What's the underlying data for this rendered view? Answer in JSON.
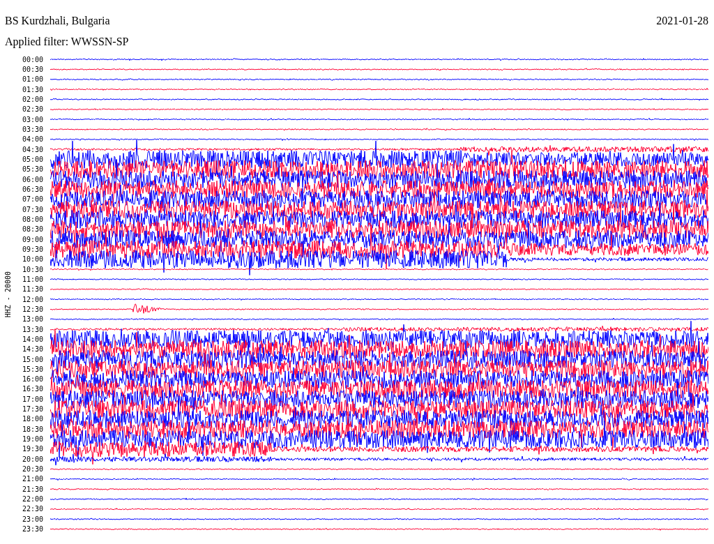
{
  "station": "BS Kurdzhali, Bulgaria",
  "date": "2021-01-28",
  "filter_label": "Applied filter: WWSSN-SP",
  "channel": "HHZ - 20000",
  "traces": [
    {
      "time": "00:00",
      "color": "#0000ff"
    },
    {
      "time": "00:30",
      "color": "#ff0033"
    },
    {
      "time": "01:00",
      "color": "#0000ff"
    },
    {
      "time": "01:30",
      "color": "#ff0033"
    },
    {
      "time": "02:00",
      "color": "#0000ff"
    },
    {
      "time": "02:30",
      "color": "#ff0033"
    },
    {
      "time": "03:00",
      "color": "#0000ff"
    },
    {
      "time": "03:30",
      "color": "#ff0033"
    },
    {
      "time": "04:00",
      "color": "#0000ff"
    },
    {
      "time": "04:30",
      "color": "#ff0033"
    },
    {
      "time": "05:00",
      "color": "#0000ff"
    },
    {
      "time": "05:30",
      "color": "#ff0033"
    },
    {
      "time": "06:00",
      "color": "#0000ff"
    },
    {
      "time": "06:30",
      "color": "#ff0033"
    },
    {
      "time": "07:00",
      "color": "#0000ff"
    },
    {
      "time": "07:30",
      "color": "#ff0033"
    },
    {
      "time": "08:00",
      "color": "#0000ff"
    },
    {
      "time": "08:30",
      "color": "#ff0033"
    },
    {
      "time": "09:00",
      "color": "#0000ff"
    },
    {
      "time": "09:30",
      "color": "#ff0033"
    },
    {
      "time": "10:00",
      "color": "#0000ff"
    },
    {
      "time": "10:30",
      "color": "#ff0033"
    },
    {
      "time": "11:00",
      "color": "#0000ff"
    },
    {
      "time": "11:30",
      "color": "#ff0033"
    },
    {
      "time": "12:00",
      "color": "#0000ff"
    },
    {
      "time": "12:30",
      "color": "#ff0033"
    },
    {
      "time": "13:00",
      "color": "#0000ff"
    },
    {
      "time": "13:30",
      "color": "#ff0033"
    },
    {
      "time": "14:00",
      "color": "#0000ff"
    },
    {
      "time": "14:30",
      "color": "#ff0033"
    },
    {
      "time": "15:00",
      "color": "#0000ff"
    },
    {
      "time": "15:30",
      "color": "#ff0033"
    },
    {
      "time": "16:00",
      "color": "#0000ff"
    },
    {
      "time": "16:30",
      "color": "#ff0033"
    },
    {
      "time": "17:00",
      "color": "#0000ff"
    },
    {
      "time": "17:30",
      "color": "#ff0033"
    },
    {
      "time": "18:00",
      "color": "#0000ff"
    },
    {
      "time": "18:30",
      "color": "#ff0033"
    },
    {
      "time": "19:00",
      "color": "#0000ff"
    },
    {
      "time": "19:30",
      "color": "#ff0033"
    },
    {
      "time": "20:00",
      "color": "#0000ff"
    },
    {
      "time": "20:30",
      "color": "#ff0033"
    },
    {
      "time": "21:00",
      "color": "#0000ff"
    },
    {
      "time": "21:30",
      "color": "#ff0033"
    },
    {
      "time": "22:00",
      "color": "#0000ff"
    },
    {
      "time": "22:30",
      "color": "#ff0033"
    },
    {
      "time": "23:00",
      "color": "#0000ff"
    },
    {
      "time": "23:30",
      "color": "#ff0033"
    }
  ]
}
